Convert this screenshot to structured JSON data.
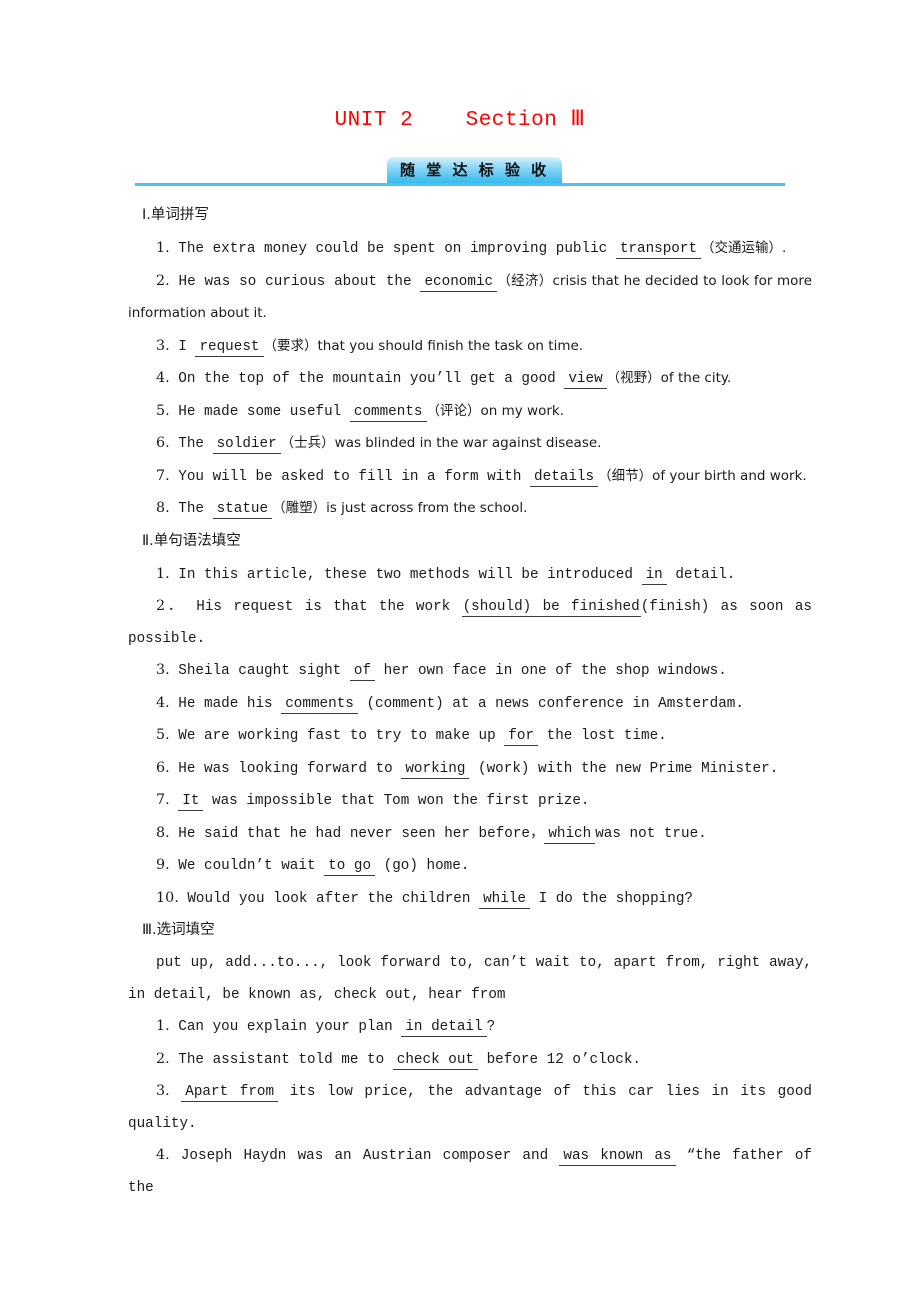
{
  "header": {
    "unit_title": "UNIT 2    Section Ⅲ",
    "banner_badge": "随 堂 达 标 验 收",
    "title_color": "#ff0000",
    "accent_color": "#4cc3ef"
  },
  "sections": [
    {
      "heading": "Ⅰ.单词拼写",
      "items": [
        {
          "num": "1.",
          "pre": "The extra money could be spent on improving public",
          "answer": "transport",
          "post": "（交通运输）."
        },
        {
          "num": "2.",
          "pre": "He was so curious about the",
          "answer": "economic",
          "post": "（经济）crisis that he decided to look for more information about it."
        },
        {
          "num": "3.",
          "pre": "I",
          "answer": "request",
          "post": "（要求）that you should finish the task on time."
        },
        {
          "num": "4.",
          "pre": "On the top of the mountain you’ll get a good",
          "answer": "view",
          "post": "（视野）of the city."
        },
        {
          "num": "5.",
          "pre": "He made some useful",
          "answer": "comments",
          "post": "（评论）on my work."
        },
        {
          "num": "6.",
          "pre": "The",
          "answer": "soldier",
          "post": "（士兵）was blinded in the war against disease."
        },
        {
          "num": "7.",
          "pre": "You will be asked to fill in a form with",
          "answer": "details",
          "post": "（细节）of your birth and work."
        },
        {
          "num": "8.",
          "pre": "The",
          "answer": "statue",
          "post": "（雕塑）is just across from the school."
        }
      ]
    },
    {
      "heading": "Ⅱ.单句语法填空",
      "items": [
        {
          "num": "1.",
          "pre": "In this article, these two methods will be introduced",
          "answer": "in",
          "post": "detail."
        },
        {
          "num": "2．",
          "pre": "His request is that the work",
          "answer": "(should) be finished",
          "post": "(finish) as soon as possible."
        },
        {
          "num": "3.",
          "pre": "Sheila caught sight",
          "answer": "of",
          "post": "her own face in one of the shop windows."
        },
        {
          "num": "4.",
          "pre": "He made his",
          "answer": "comments",
          "post": "(comment) at a news conference in Amsterdam."
        },
        {
          "num": "5.",
          "pre": "We are working fast to try to make up",
          "answer": "for",
          "post": "the lost time."
        },
        {
          "num": "6.",
          "pre": "He was looking forward to",
          "answer": "working",
          "post": "(work) with the new Prime Minister."
        },
        {
          "num": "7.",
          "pre": "",
          "answer": "It",
          "post": "was impossible that Tom won the first prize."
        },
        {
          "num": "8.",
          "pre": "He said that he had never seen her before，",
          "answer": "which",
          "post": "was not true."
        },
        {
          "num": "9.",
          "pre": "We couldn’t wait",
          "answer": "to go",
          "post": "(go) home."
        },
        {
          "num": "10.",
          "pre": "Would you look after the children",
          "answer": "while",
          "post": "I do the shopping?"
        }
      ]
    },
    {
      "heading": "Ⅲ.选词填空",
      "wordbank": "put up, add...to..., look forward to, can’t wait to, apart from, right away, in detail, be known as, check out, hear from",
      "items": [
        {
          "num": "1.",
          "pre": "Can you explain your plan",
          "answer": "in detail",
          "post": "?"
        },
        {
          "num": "2.",
          "pre": "The assistant told me to",
          "answer": "check out",
          "post": "before 12 o’clock."
        },
        {
          "num": "3.",
          "pre": "",
          "answer": "Apart from",
          "post": "its low price, the advantage of this car lies in its good quality."
        },
        {
          "num": "4.",
          "pre": "Joseph Haydn was an Austrian composer and",
          "answer": "was known as",
          "post": "“the father of the"
        }
      ]
    }
  ]
}
